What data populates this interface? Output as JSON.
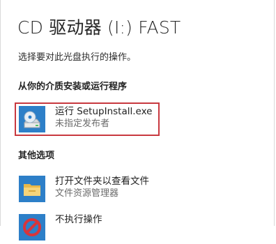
{
  "dialog": {
    "title": "CD 驱动器 (I:) FAST",
    "subtitle": "选择要对此光盘执行的操作。"
  },
  "sections": {
    "install": {
      "heading": "从你的介质安装或运行程序",
      "option": {
        "label": "运行 SetupInstall.exe",
        "sublabel": "未指定发布者",
        "icon": "cd-drive-icon"
      }
    },
    "other": {
      "heading": "其他选项",
      "options": [
        {
          "label": "打开文件夹以查看文件",
          "sublabel": "文件资源管理器",
          "icon": "folder-icon"
        },
        {
          "label": "不执行操作",
          "sublabel": "",
          "icon": "no-action-icon"
        }
      ]
    }
  },
  "colors": {
    "highlight_border": "#c8383f",
    "tile_blue": "#2d7fc8"
  }
}
